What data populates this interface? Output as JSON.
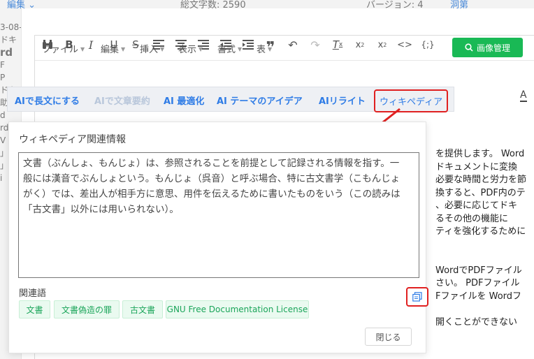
{
  "background": {
    "top_left": "編集 ⌄",
    "top_mid": "総文字数:  2590",
    "top_right": "バージョン:  4",
    "top_right_link": "洞第",
    "left_fragments": [
      "3-08-",
      "",
      "ドキ",
      "",
      "",
      "",
      "",
      "",
      "",
      "rd",
      "",
      "F",
      "P",
      "ドキ",
      "",
      "助",
      "",
      "d",
      "rd'",
      "V",
      "」",
      "」",
      "i"
    ]
  },
  "menubar": {
    "items": [
      "ファイル",
      "編集",
      "挿入",
      "表示",
      "書式",
      "表"
    ],
    "image_button": "画像管理"
  },
  "toolbar": {
    "icons": [
      "binoculars-icon",
      "bold-icon",
      "italic-icon",
      "underline-icon",
      "strikethrough-icon",
      "align-left-icon",
      "align-center-icon",
      "align-right-icon",
      "outdent-icon",
      "indent-icon",
      "quote-icon",
      "undo-icon",
      "redo-icon",
      "clear-format-icon",
      "subscript-icon",
      "superscript-icon",
      "code-icon",
      "template-icon"
    ]
  },
  "ai_bar": {
    "items": [
      "AIで長文にする",
      "AIで文章要約",
      "AI 最適化",
      "AI テーマのアイデア",
      "AIリライト",
      "ウィキペディア"
    ],
    "font_letter": "A"
  },
  "editor_text": [
    "を提供します。 Word",
    "ドキュメントに変換",
    "必要な時間と労力を節",
    "換すると、PDF内のテ",
    "、必要に応じてドキ",
    "るその他の機能に",
    "ティを強化するために",
    "",
    "",
    "WordでPDFファイル",
    "さい。 PDFファイル",
    "Fファイルを Wordフ",
    "",
    "開くことができない"
  ],
  "wiki_panel": {
    "title": "ウィキペディア関連情報",
    "text_lines": [
      "文書（ぶんしょ、もんじょ）は、参照されることを前提として記録される情報を指す。一",
      "般には漢音でぶんしょという。もんじょ（呉音）と呼ぶ場合、特に古文書学（こもんじょ",
      "がく）では、差出人が相手方に意思、用件を伝えるために書いたものをいう（この読みは",
      "「古文書」以外には用いられない）。"
    ],
    "related_label": "関連語",
    "tags": [
      "文書",
      "文書偽造の罪",
      "古文書",
      "GNU Free Documentation License"
    ],
    "close_button": "閉じる"
  },
  "colors": {
    "accent_green": "#19b955",
    "ai_blue": "#2f7ce6",
    "highlight_red": "#e02020",
    "tag_green": "#1ba55a"
  }
}
